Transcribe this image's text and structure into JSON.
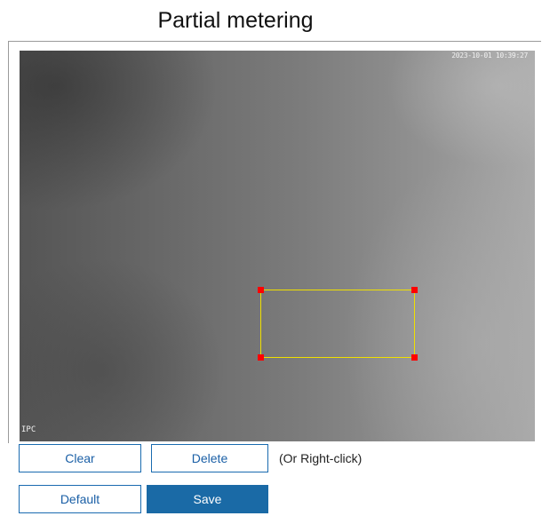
{
  "page": {
    "title": "Partial metering"
  },
  "video": {
    "timestamp": "2023-10-01 10:39:27",
    "corner_label": "IPC"
  },
  "buttons": {
    "clear": "Clear",
    "delete": "Delete",
    "delete_hint": "(Or Right-click)",
    "default": "Default",
    "save": "Save"
  },
  "colors": {
    "roi_border": "#f0e000",
    "roi_handle": "#ff0000",
    "button_accent": "#1a6aa6"
  }
}
